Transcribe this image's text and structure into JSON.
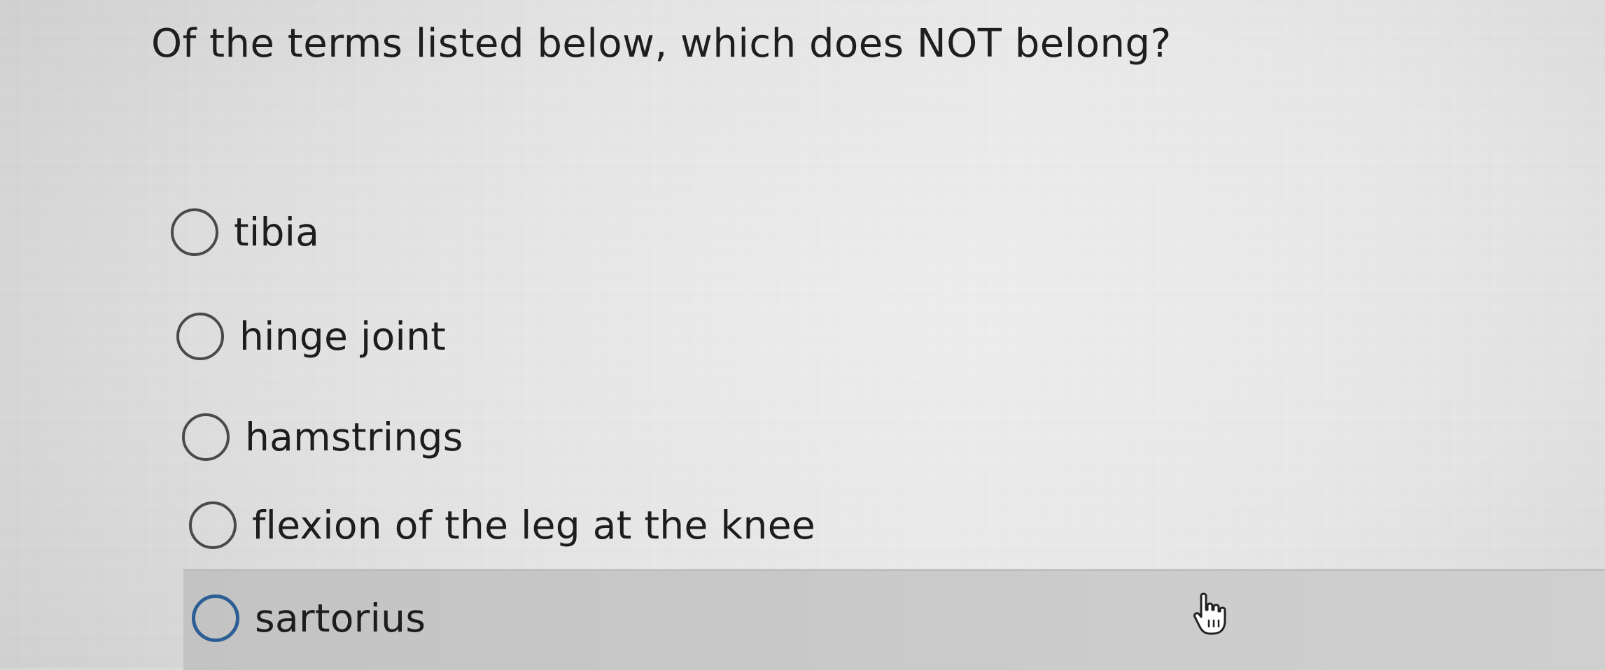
{
  "question": {
    "text": "Of the terms listed below, which does NOT belong?"
  },
  "options": [
    {
      "label": "tibia",
      "selected": false,
      "hovered": false
    },
    {
      "label": "hinge joint",
      "selected": false,
      "hovered": false
    },
    {
      "label": "hamstrings",
      "selected": false,
      "hovered": false
    },
    {
      "label": "flexion of the leg at the knee",
      "selected": false,
      "hovered": false
    },
    {
      "label": "sartorius",
      "selected": false,
      "hovered": true
    }
  ],
  "colors": {
    "focus_ring": "#2d5f95",
    "hover_row": "#c8c8c8",
    "text": "#1e1e1e"
  },
  "icons": {
    "pointer": "hand-pointer-icon"
  }
}
